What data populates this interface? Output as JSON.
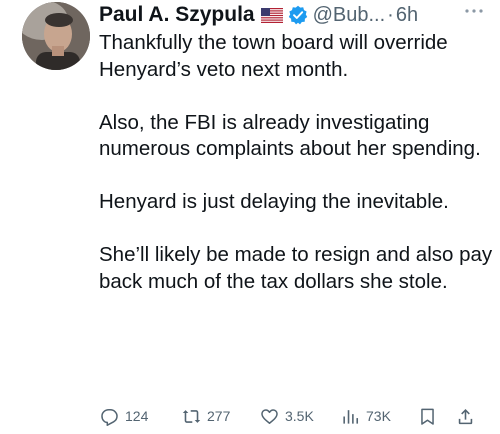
{
  "tweet": {
    "author_name": "Paul A. Szypula",
    "handle": "@Bub...",
    "separator": "·",
    "time": "6h",
    "paragraphs": [
      "Thankfully the town board will override Henyard’s veto next month.",
      "Also, the FBI is already investigating numerous complaints about her spending.",
      "Henyard is just delaying the inevitable.",
      "She’ll likely be made to resign and also pay back much of the tax dollars she stole."
    ],
    "stats": {
      "replies": "124",
      "reposts": "277",
      "likes": "3.5K",
      "views": "73K"
    },
    "icons": {
      "flag": "us-flag-icon",
      "verified": "verified-badge-icon",
      "more": "more-icon",
      "reply": "reply-icon",
      "repost": "repost-icon",
      "like": "like-icon",
      "views": "views-icon",
      "bookmark": "bookmark-icon",
      "share": "share-icon"
    },
    "colors": {
      "text": "#0f1419",
      "secondary": "#536471",
      "verified": "#1d9bf0"
    }
  }
}
